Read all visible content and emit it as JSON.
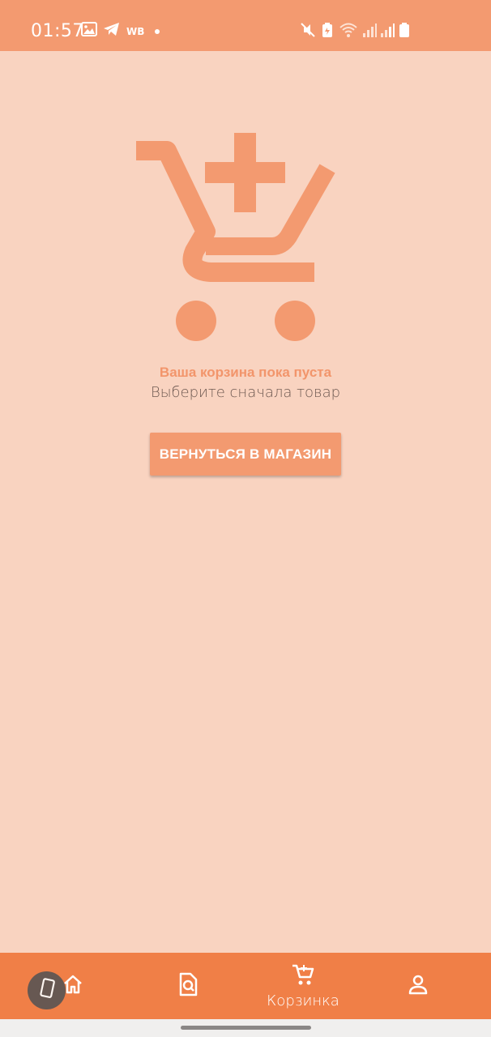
{
  "status_bar": {
    "time": "01:57",
    "carrier_tag": "WB",
    "left_icons": [
      "gallery-icon",
      "telegram-icon"
    ],
    "right_icons": [
      "mute-icon",
      "battery-saver-icon",
      "wifi-icon",
      "signal-icon",
      "signal-icon",
      "battery-icon"
    ]
  },
  "empty_cart": {
    "icon": "cart-plus-icon",
    "title": "Ваша корзина пока пуста",
    "subtitle": "Выберите сначала товар",
    "button_label": "ВЕРНУТЬСЯ В МАГАЗИН"
  },
  "bottom_nav": {
    "items": [
      {
        "icon": "home-icon",
        "label": ""
      },
      {
        "icon": "search-document-icon",
        "label": ""
      },
      {
        "icon": "cart-icon",
        "label": "Корзинка",
        "active": true
      },
      {
        "icon": "profile-icon",
        "label": ""
      }
    ]
  },
  "colors": {
    "status_bar": "#f39a70",
    "background": "#f9d3c0",
    "accent": "#f39a70",
    "bottom_nav": "#f07f47"
  }
}
